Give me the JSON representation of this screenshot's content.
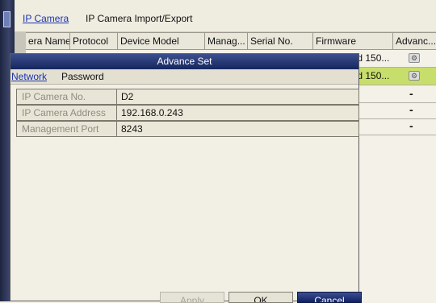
{
  "tabs": [
    "IP Camera",
    "IP Camera Import/Export"
  ],
  "grid": {
    "columns": [
      "era Name",
      "Protocol",
      "Device Model",
      "Manag...",
      "Serial No.",
      "Firmware",
      "Advanc..."
    ],
    "rows": [
      {
        "firmware": "ild 150...",
        "advanced": "icon",
        "highlight": false
      },
      {
        "firmware": "ild 150...",
        "advanced": "icon",
        "highlight": true
      },
      {
        "firmware": "",
        "advanced": "-",
        "highlight": false
      },
      {
        "firmware": "",
        "advanced": "-",
        "highlight": false
      },
      {
        "firmware": "",
        "advanced": "-",
        "highlight": false
      }
    ]
  },
  "dialog": {
    "title": "Advance Set",
    "tabs": [
      "Network",
      "Password"
    ],
    "fields": [
      {
        "label": "IP Camera No.",
        "value": "D2"
      },
      {
        "label": "IP Camera Address",
        "value": "192.168.0.243"
      },
      {
        "label": "Management Port",
        "value": "8243"
      }
    ],
    "buttons": {
      "apply": "Apply",
      "ok": "OK",
      "cancel": "Cancel"
    }
  },
  "colors": {
    "accent": "#1a34b3",
    "title_bar": "#1f3270",
    "row_highlight": "#c8de6c"
  }
}
